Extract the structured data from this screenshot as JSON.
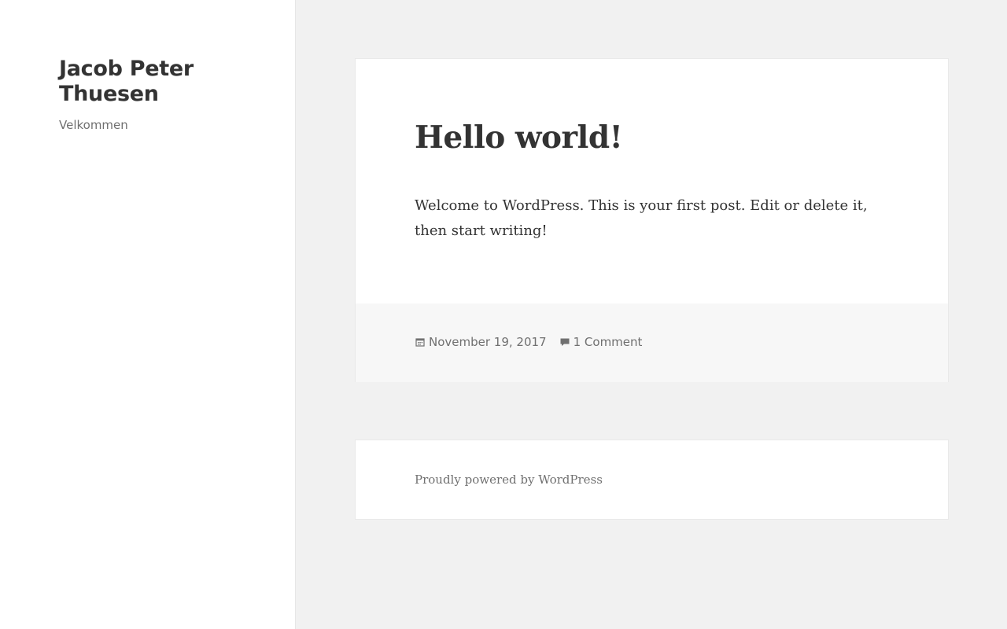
{
  "site": {
    "title": "Jacob Peter Thuesen",
    "description": "Velkommen"
  },
  "post": {
    "title": "Hello world!",
    "content": "Welcome to WordPress. This is your first post. Edit or delete it, then start writing!",
    "date": "November 19, 2017",
    "comments": "1 Comment",
    "date_icon": "calendar-icon",
    "comments_icon": "comment-icon"
  },
  "footer": {
    "powered_by": "Proudly powered by WordPress"
  },
  "colors": {
    "background": "#f1f1f1",
    "card": "#ffffff",
    "card_footer": "#f7f7f7",
    "text": "#333333",
    "muted": "#707070"
  }
}
